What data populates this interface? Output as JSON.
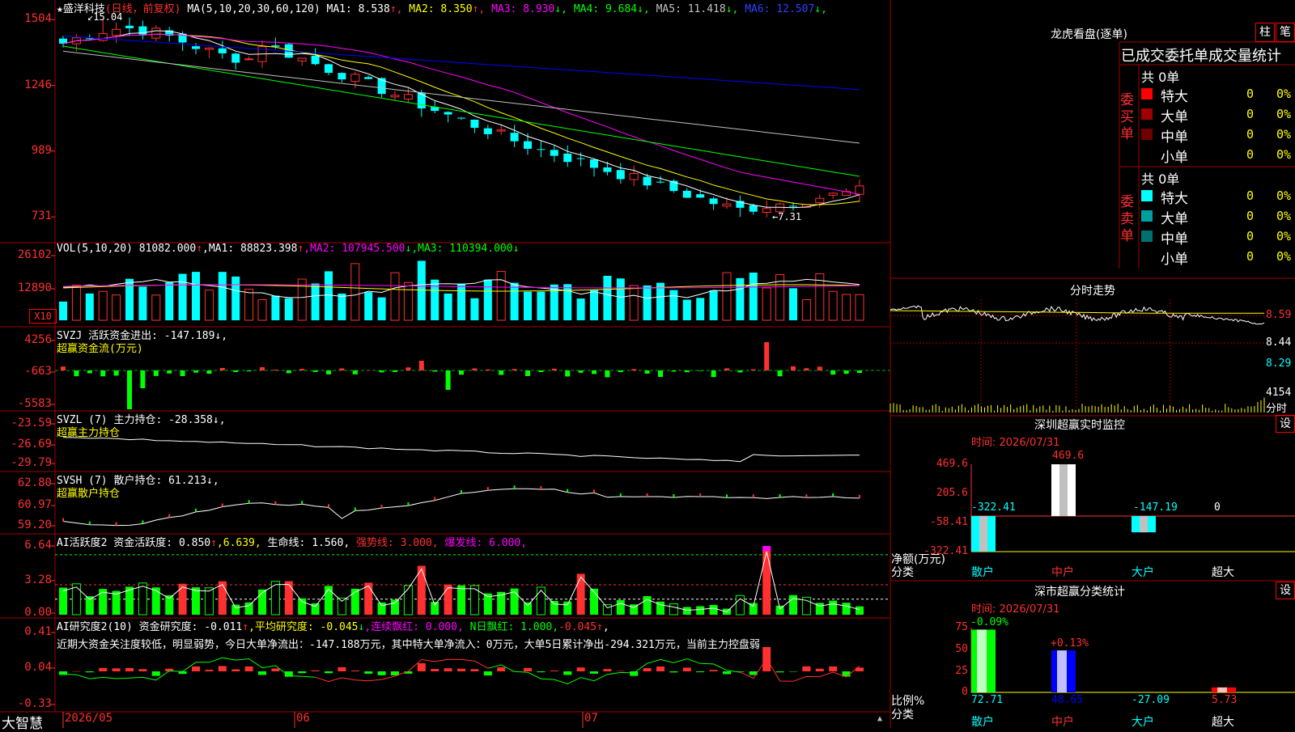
{
  "app": {
    "brand": "大智慧"
  },
  "stock": {
    "star": "★",
    "name": "盛洋科技",
    "period": "(日线，前复权)"
  },
  "colors": {
    "up": "#ff3030",
    "down": "#00ffff",
    "panel_border": "#a00000",
    "bg": "#000000",
    "axis": "#ff3030",
    "ma1": "#ffffff",
    "ma2": "#ffff00",
    "ma3": "#ff00ff",
    "ma4": "#00ff00",
    "ma5": "#c0c0c0",
    "ma6": "#0000ff"
  },
  "main": {
    "ma_header": "MA(5,10,20,30,60,120)",
    "ma": [
      {
        "label": "MA1:",
        "value": "8.538",
        "arrow": "↑",
        "color": "#ffffff"
      },
      {
        "label": "MA2:",
        "value": "8.350",
        "arrow": "↑",
        "color": "#ffff00"
      },
      {
        "label": "MA3:",
        "value": "8.930",
        "arrow": "↓",
        "color": "#ff00ff"
      },
      {
        "label": "MA4:",
        "value": "9.684",
        "arrow": "↓",
        "color": "#00ff00"
      },
      {
        "label": "MA5:",
        "value": "11.418",
        "arrow": "↓",
        "color": "#c0c0c0"
      },
      {
        "label": "MA6:",
        "value": "12.507",
        "arrow": "↓",
        "color": "#3040ff"
      }
    ],
    "y_ticks": [
      "1504",
      "1246",
      "989",
      "731"
    ],
    "y_values": [
      15.04,
      12.46,
      9.89,
      7.31
    ],
    "high_label": "15.04",
    "low_label": "7.31"
  },
  "vol": {
    "header": "VOL(5,10,20)",
    "current": "81082.000",
    "current_arrow": "↑",
    "ma": [
      {
        "label": "MA1:",
        "value": "88823.398",
        "arrow": "↑",
        "color": "#ffffff"
      },
      {
        "label": "MA2:",
        "value": "107945.500",
        "arrow": "↓",
        "color": "#ff00ff"
      },
      {
        "label": "MA3:",
        "value": "110394.000",
        "arrow": "↓",
        "color": "#00ff00"
      }
    ],
    "y_ticks": [
      "26102",
      "12890"
    ],
    "unit": "X10"
  },
  "svzj": {
    "header": "SVZJ  活跃资金进出: -147.189↓,",
    "sub": "超赢资金流(万元)",
    "y_ticks": [
      "4256",
      "-663",
      "-5583"
    ]
  },
  "svzl": {
    "header": "SVZL (7) 主力持仓: -28.358↓,",
    "sub": "超赢主力持仓",
    "y_ticks": [
      "-23.59",
      "-26.69",
      "-29.79"
    ]
  },
  "svsh": {
    "header": "SVSH (7) 散户持仓: 61.213↓,",
    "sub": "超赢散户持仓",
    "y_ticks": [
      "62.80",
      "60.97",
      "59.20"
    ]
  },
  "ai1": {
    "header_a": "AI活跃度2 资金活跃度: 0.850",
    "arrow_a": "↑",
    "header_b": ",6.639,",
    "header_c": "生命线: 1.560,",
    "header_d": "强势线: 3.000,",
    "header_e": "爆发线: 6.000,",
    "y_ticks": [
      "6.64",
      "3.28",
      "0.00"
    ]
  },
  "ai2": {
    "header_a": "AI研究度2(10) 资金研究度: -0.011",
    "arrow_a": "↑",
    "header_b": ",平均研究度: -0.045",
    "arrow_b": "↓",
    "header_c": ",连续飘红: 0.000,",
    "header_d": "N日飘红: 1.000,",
    "header_e": "-0.045",
    "arrow_e": "↑",
    "header_f": ",",
    "comment": "近期大资金关注度较低，明显弱势，今日大单净流出：-147.188万元，其中特大单净流入：0万元，大单5日累计净出-294.321万元，当前主力控盘弱",
    "y_ticks": [
      "0.41",
      "0.04",
      "-0.33"
    ]
  },
  "xaxis": {
    "labels": [
      "2026/05",
      "06",
      "07"
    ]
  },
  "right": {
    "lhb_title": "龙虎看盘(逐单)",
    "tab1": "柱",
    "tab2": "笔",
    "orders_title": "已成交委托单成交量统计",
    "buy_side": {
      "vlabel": "委\n买\n单",
      "total": "共 0单",
      "rows": [
        {
          "label": "特大",
          "value": "0",
          "pct": "0%",
          "color": "#ff0000"
        },
        {
          "label": "大单",
          "value": "0",
          "pct": "0%",
          "color": "#a00000"
        },
        {
          "label": "中单",
          "value": "0",
          "pct": "0%",
          "color": "#700000"
        },
        {
          "label": "小单",
          "value": "0",
          "pct": "0%",
          "color": "#000000"
        }
      ]
    },
    "sell_side": {
      "vlabel": "委\n卖\n单",
      "total": "共 0单",
      "rows": [
        {
          "label": "特大",
          "value": "0",
          "pct": "0%",
          "color": "#00ffff"
        },
        {
          "label": "大单",
          "value": "0",
          "pct": "0%",
          "color": "#00a0a0"
        },
        {
          "label": "中单",
          "value": "0",
          "pct": "0%",
          "color": "#007070"
        },
        {
          "label": "小单",
          "value": "0",
          "pct": "0%",
          "color": "#000000"
        }
      ]
    },
    "intraday": {
      "title": "分时走势",
      "y_labels": [
        "8.59",
        "8.44",
        "8.29"
      ],
      "vol_label": "4154",
      "vol_unit": "分时"
    },
    "monitor": {
      "title": "深圳超赢实时监控",
      "set": "设",
      "time": "时间: 2026/07/31",
      "y_ticks": [
        "469.6",
        "205.6",
        "-58.41",
        "-322.41"
      ],
      "ylabel": "净额(万元)",
      "xlabel": "分类",
      "categories": [
        "散户",
        "中户",
        "大户",
        "超大"
      ],
      "values": [
        -322.41,
        469.6,
        -147.19,
        0
      ],
      "value_labels": [
        "-322.41",
        "469.6",
        "-147.19",
        "0"
      ]
    },
    "classify": {
      "title": "深市超赢分类统计",
      "set": "设",
      "time": "时间: 2026/07/31",
      "y_ticks": [
        "75",
        "50",
        "25",
        "0"
      ],
      "ylabel": "比例%",
      "xlabel": "分类",
      "categories": [
        "散户",
        "中户",
        "大户",
        "超大"
      ],
      "values": [
        72.71,
        48.65,
        -27.09,
        5.73
      ],
      "value_labels": [
        "72.71",
        "48.65",
        "-27.09",
        "5.73"
      ],
      "change_labels": [
        "-0.09%",
        "+0.13%",
        "",
        ""
      ]
    }
  }
}
